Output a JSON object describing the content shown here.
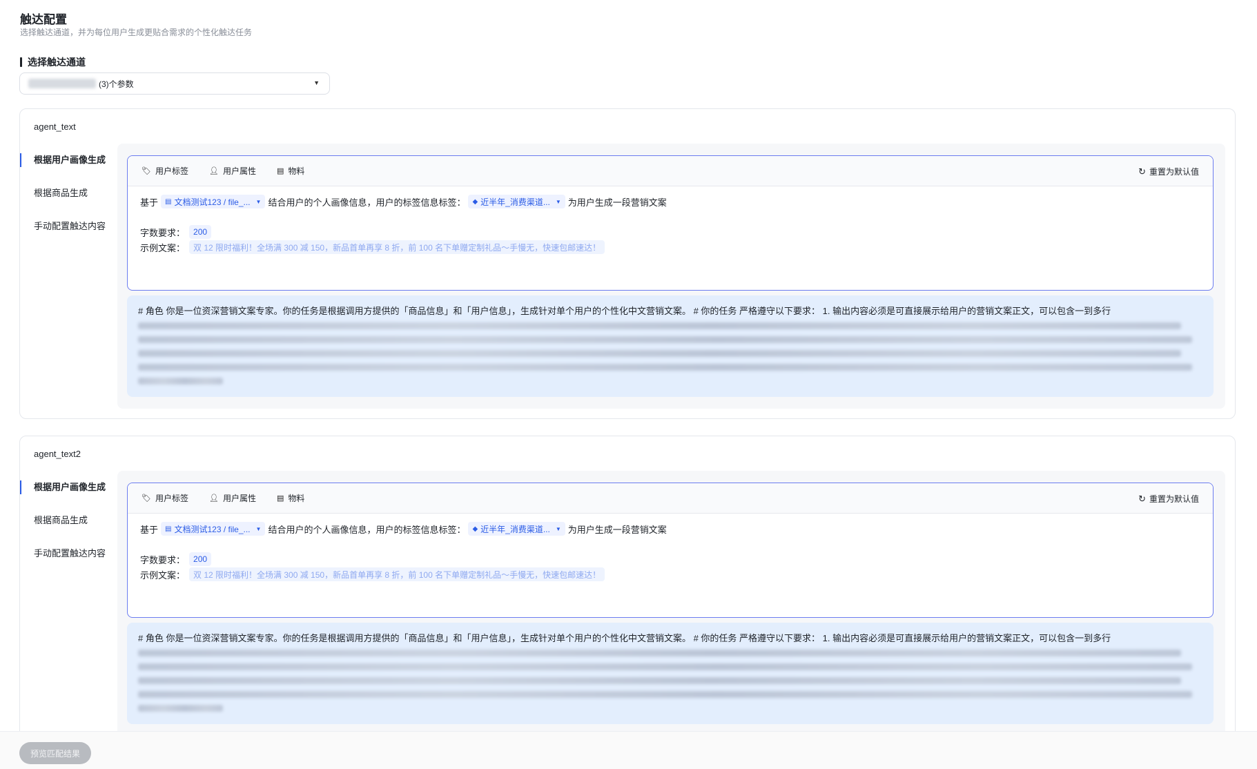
{
  "header": {
    "title": "触达配置",
    "subtitle": "选择触达通道，并为每位用户生成更贴合需求的个性化触达任务"
  },
  "channel": {
    "section_label": "选择触达通道",
    "select_suffix": "(3)个参数"
  },
  "agents": [
    {
      "name": "agent_text",
      "nav": [
        "根据用户画像生成",
        "根据商品生成",
        "手动配置触达内容"
      ],
      "toolbar": {
        "tag": "用户标签",
        "attr": "用户属性",
        "material": "物料",
        "reset": "重置为默认值"
      },
      "line1": {
        "prefix": "基于",
        "doc_chip": "文档测试123 / file_...",
        "middle": "结合用户的个人画像信息，用户的标签信息标签：",
        "tag_chip": "近半年_消费渠道...",
        "suffix": "为用户生成一段营销文案"
      },
      "word_label": "字数要求：",
      "word_value": "200",
      "example_label": "示例文案：",
      "example_value": "双 12 限时福利！全场满 300 减 150，新品首单再享 8 折，前 100 名下单赠定制礼品～手慢无，快速包邮速达！",
      "prompt_first_line": "# 角色 你是一位资深营销文案专家。你的任务是根据调用方提供的「商品信息」和「用户信息」，生成针对单个用户的个性化中文营销文案。 # 你的任务 严格遵守以下要求： 1. 输出内容必须是可直接展示给用户的营销文案正文，可以包含一到多行"
    },
    {
      "name": "agent_text2",
      "nav": [
        "根据用户画像生成",
        "根据商品生成",
        "手动配置触达内容"
      ],
      "toolbar": {
        "tag": "用户标签",
        "attr": "用户属性",
        "material": "物料",
        "reset": "重置为默认值"
      },
      "line1": {
        "prefix": "基于",
        "doc_chip": "文档测试123 / file_...",
        "middle": "结合用户的个人画像信息，用户的标签信息标签：",
        "tag_chip": "近半年_消费渠道...",
        "suffix": "为用户生成一段营销文案"
      },
      "word_label": "字数要求：",
      "word_value": "200",
      "example_label": "示例文案：",
      "example_value": "双 12 限时福利！全场满 300 减 150，新品首单再享 8 折，前 100 名下单赠定制礼品～手慢无，快速包邮速达！",
      "prompt_first_line": "# 角色 你是一位资深营销文案专家。你的任务是根据调用方提供的「商品信息」和「用户信息」，生成针对单个用户的个性化中文营销文案。 # 你的任务 严格遵守以下要求： 1. 输出内容必须是可直接展示给用户的营销文案正文，可以包含一到多行"
    }
  ],
  "footer": {
    "preview_button": "预览匹配结果"
  },
  "icons": {
    "tag": "tag-icon",
    "user": "user-icon",
    "material": "material-icon",
    "reset": "refresh-icon",
    "doc": "document-icon",
    "caret": "caret-down-icon"
  },
  "colors": {
    "accent": "#2b5ce6",
    "editor_border": "#6b7cf0",
    "prompt_bg": "#e3eefd"
  }
}
